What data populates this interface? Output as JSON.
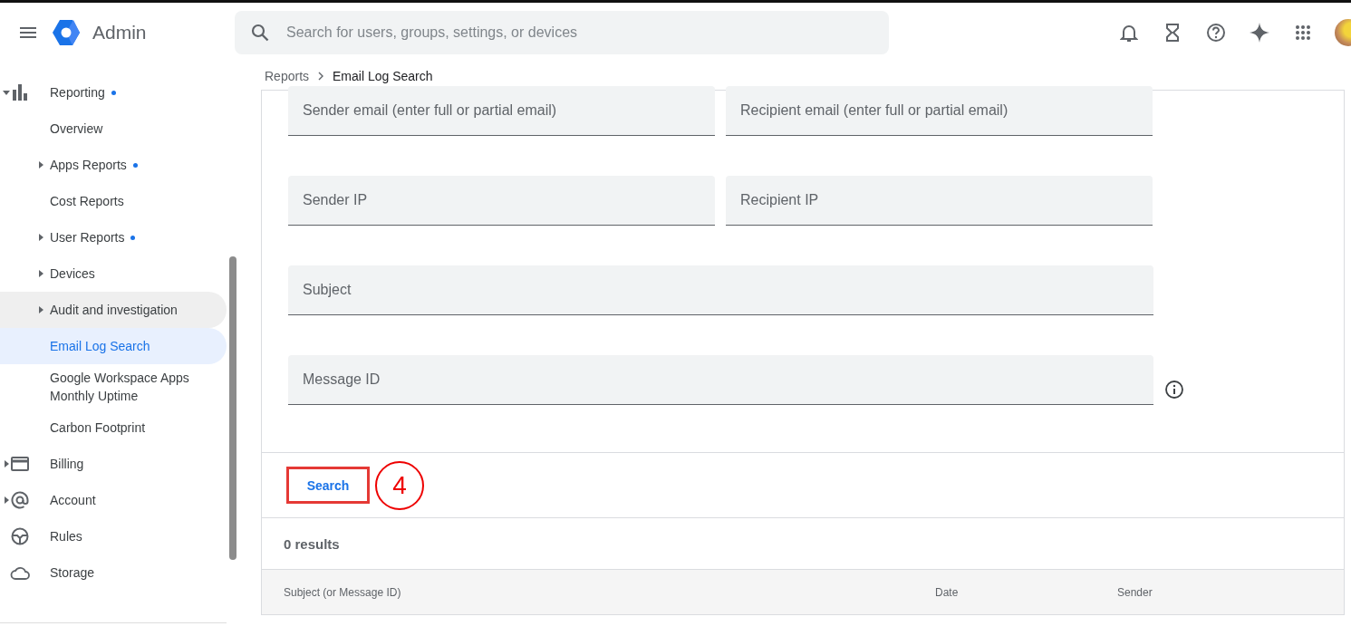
{
  "header": {
    "app_name": "Admin",
    "search": {
      "placeholder": "Search for users, groups, settings, or devices"
    }
  },
  "sidebar": {
    "items": [
      {
        "label": "Reporting",
        "expandable": true,
        "expanded": true,
        "dot": true,
        "selected": false,
        "children": [
          {
            "label": "Overview",
            "expandable": false,
            "dot": false,
            "selected": false,
            "hover": false
          },
          {
            "label": "Apps Reports",
            "expandable": true,
            "dot": true,
            "selected": false,
            "hover": false
          },
          {
            "label": "Cost Reports",
            "expandable": false,
            "dot": false,
            "selected": false,
            "hover": false
          },
          {
            "label": "User Reports",
            "expandable": true,
            "dot": true,
            "selected": false,
            "hover": false
          },
          {
            "label": "Devices",
            "expandable": true,
            "dot": false,
            "selected": false,
            "hover": false
          },
          {
            "label": "Audit and investigation",
            "expandable": true,
            "dot": false,
            "selected": false,
            "hover": true
          },
          {
            "label": "Email Log Search",
            "expandable": false,
            "dot": false,
            "selected": true,
            "hover": false
          },
          {
            "label": "Google Workspace Apps Monthly Uptime",
            "expandable": false,
            "dot": false,
            "selected": false,
            "hover": false
          },
          {
            "label": "Carbon Footprint",
            "expandable": false,
            "dot": false,
            "selected": false,
            "hover": false
          }
        ]
      },
      {
        "label": "Billing",
        "expandable": true,
        "dot": false,
        "selected": false
      },
      {
        "label": "Account",
        "expandable": true,
        "dot": false,
        "selected": false
      },
      {
        "label": "Rules",
        "expandable": false,
        "dot": false,
        "selected": false
      },
      {
        "label": "Storage",
        "expandable": false,
        "dot": false,
        "selected": false
      }
    ]
  },
  "breadcrumb": [
    "Reports",
    "Email Log Search"
  ],
  "form": {
    "rows": [
      [
        {
          "placeholder": "Sender email (enter full or partial email)"
        },
        {
          "placeholder": "Recipient email (enter full or partial email)"
        }
      ],
      [
        {
          "placeholder": "Sender IP"
        },
        {
          "placeholder": "Recipient IP"
        }
      ],
      [
        {
          "placeholder": "Subject"
        }
      ],
      [
        {
          "placeholder": "Message ID",
          "info": true
        }
      ]
    ]
  },
  "search_button": {
    "label": "Search",
    "annotation": "4"
  },
  "results": {
    "count": "0 results",
    "columns": [
      "Subject (or Message ID)",
      "Date",
      "Sender"
    ]
  }
}
